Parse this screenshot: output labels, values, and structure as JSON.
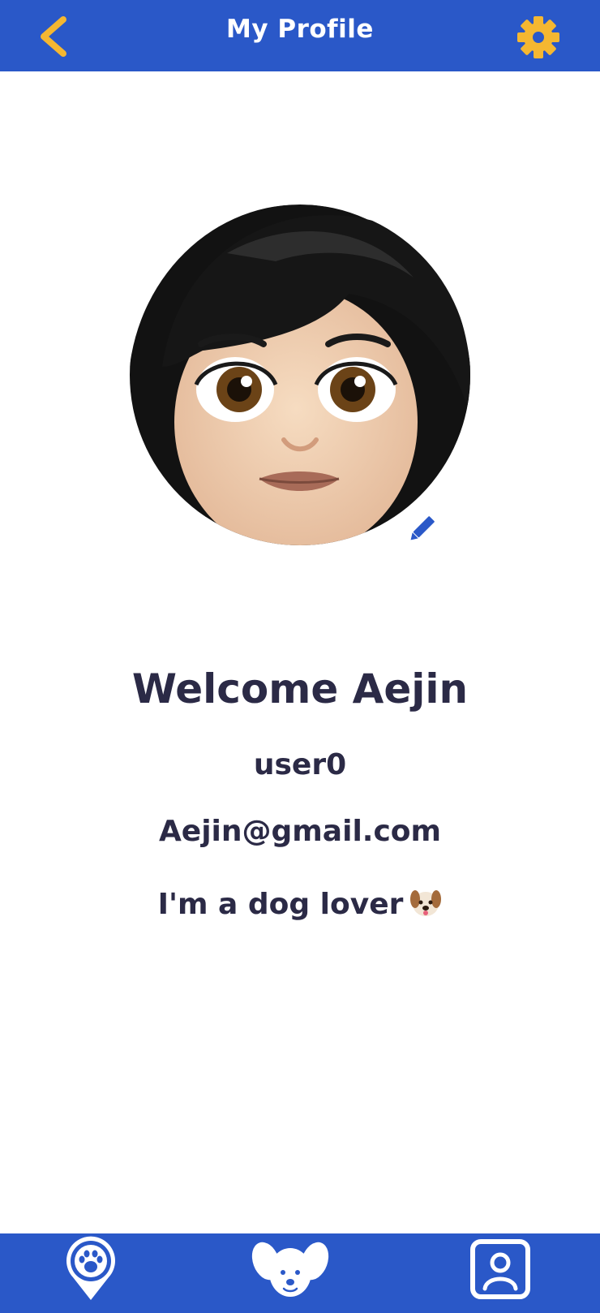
{
  "header": {
    "title": "My Profile",
    "back_icon": "chevron-left-icon",
    "settings_icon": "gear-icon"
  },
  "profile": {
    "avatar": "woman-emoji-avatar",
    "edit_icon": "pencil-icon",
    "welcome_text": "Welcome Aejin",
    "username": "user0",
    "email": "Aejin@gmail.com",
    "bio": "I'm a dog lover",
    "bio_icon": "dog-face-icon"
  },
  "bottom_nav": {
    "items": [
      {
        "icon": "paw-map-pin-icon"
      },
      {
        "icon": "dog-face-icon"
      },
      {
        "icon": "profile-card-icon"
      }
    ]
  },
  "colors": {
    "primary": "#2a58c8",
    "accent": "#f5b731",
    "text": "#2b2a46",
    "background": "#ffffff"
  }
}
